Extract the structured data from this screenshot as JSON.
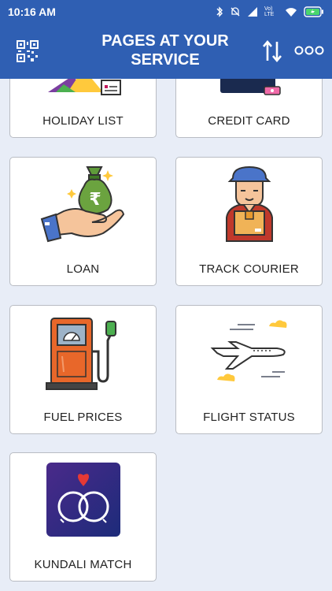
{
  "status_bar": {
    "time": "10:16 AM",
    "network_label": "Vo) LTE"
  },
  "app_bar": {
    "title": "PAGES AT YOUR SERVICE",
    "qr_icon": "qr-code-icon",
    "sort_icon": "sort-arrows-icon",
    "more_icon": "more-dots-icon",
    "color": "#2f5fb3"
  },
  "cards": [
    {
      "label": "HOLIDAY LIST",
      "icon": "holiday-icon"
    },
    {
      "label": "CREDIT CARD",
      "icon": "credit-card-icon"
    },
    {
      "label": "LOAN",
      "icon": "loan-money-bag-icon"
    },
    {
      "label": "TRACK COURIER",
      "icon": "courier-delivery-icon"
    },
    {
      "label": "FUEL PRICES",
      "icon": "fuel-pump-icon"
    },
    {
      "label": "FLIGHT STATUS",
      "icon": "airplane-icon"
    },
    {
      "label": "KUNDALI MATCH",
      "icon": "kundali-rings-icon"
    }
  ]
}
